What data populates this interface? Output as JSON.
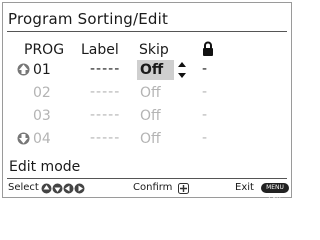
{
  "title": "Program Sorting/Edit",
  "columns": {
    "prog": "PROG",
    "label": "Label",
    "skip": "Skip"
  },
  "lock_icon": "lock-icon",
  "rows": [
    {
      "prog": "01",
      "label": "-----",
      "skip": "Off",
      "lock": "-",
      "selected": true
    },
    {
      "prog": "02",
      "label": "-----",
      "skip": "Off",
      "lock": "-"
    },
    {
      "prog": "03",
      "label": "-----",
      "skip": "Off",
      "lock": "-"
    },
    {
      "prog": "04",
      "label": "-----",
      "skip": "Off",
      "lock": "-"
    }
  ],
  "mode": "Edit mode",
  "footer": {
    "select": "Select",
    "confirm": "Confirm",
    "exit": "Exit",
    "exit_button_text": "MENU EXIT"
  },
  "colors": {
    "highlight": "#cfcfcf",
    "dim_text": "#b4b4b4",
    "rule": "#555555"
  }
}
